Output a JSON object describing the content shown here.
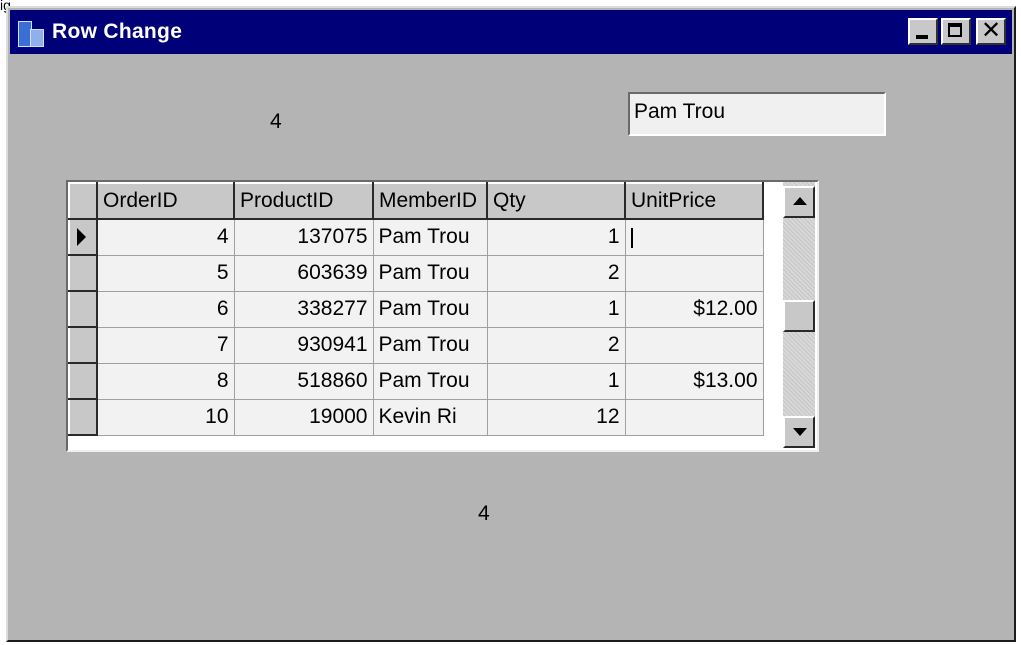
{
  "caption": "ig",
  "window": {
    "title": "Row Change",
    "icon": "app-icon",
    "controls": {
      "minimize": "minimize-icon",
      "maximize": "maximize-icon",
      "close": "✕"
    }
  },
  "labels": {
    "top_value": "4",
    "bottom_value": "4"
  },
  "member_textbox": {
    "value": "Pam Trou"
  },
  "grid": {
    "columns": [
      "OrderID",
      "ProductID",
      "MemberID",
      "Qty",
      "UnitPrice"
    ],
    "rows": [
      {
        "current": true,
        "OrderID": "4",
        "ProductID": "137075",
        "MemberID": "Pam Trou",
        "Qty": "1",
        "UnitPrice": ""
      },
      {
        "current": false,
        "OrderID": "5",
        "ProductID": "603639",
        "MemberID": "Pam Trou",
        "Qty": "2",
        "UnitPrice": ""
      },
      {
        "current": false,
        "OrderID": "6",
        "ProductID": "338277",
        "MemberID": "Pam Trou",
        "Qty": "1",
        "UnitPrice": "$12.00"
      },
      {
        "current": false,
        "OrderID": "7",
        "ProductID": "930941",
        "MemberID": "Pam Trou",
        "Qty": "2",
        "UnitPrice": ""
      },
      {
        "current": false,
        "OrderID": "8",
        "ProductID": "518860",
        "MemberID": "Pam Trou",
        "Qty": "1",
        "UnitPrice": "$13.00"
      },
      {
        "current": false,
        "OrderID": "10",
        "ProductID": "19000",
        "MemberID": "Kevin Ri",
        "Qty": "12",
        "UnitPrice": ""
      }
    ]
  }
}
